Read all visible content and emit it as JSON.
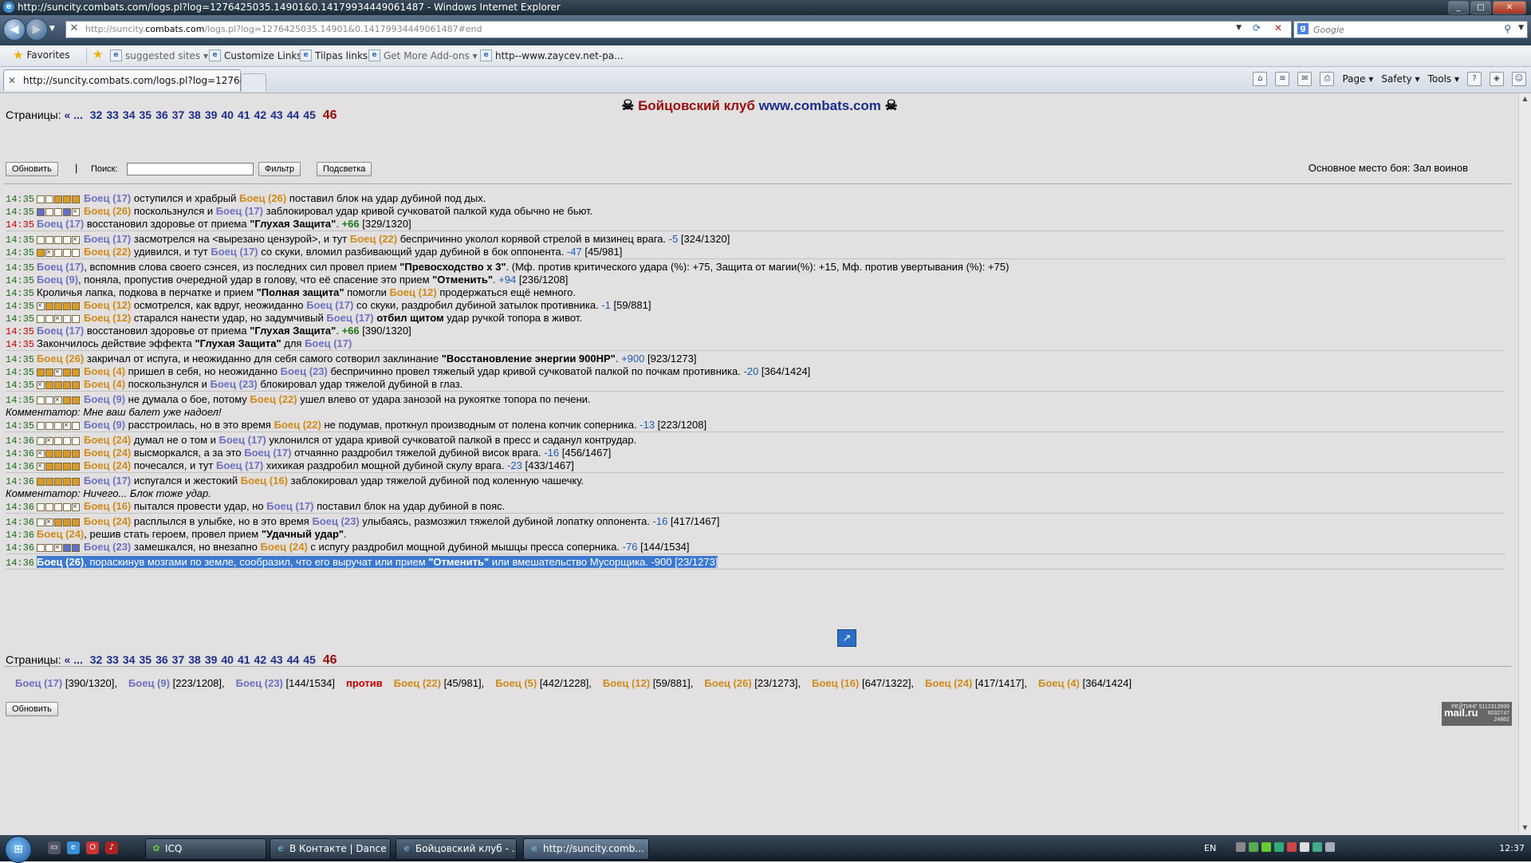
{
  "window": {
    "title": "http://suncity.combats.com/logs.pl?log=1276425035.14901&0.14179934449061487 - Windows Internet Explorer",
    "min": "_",
    "max": "□",
    "close": "✕"
  },
  "address": {
    "url_prefix": "http://suncity.",
    "url_domain": "combats.com",
    "url_suffix": "/logs.pl?log=1276425035.14901&0.14179934449061487#end",
    "search_placeholder": "Google"
  },
  "favorites": {
    "favorites_label": "Favorites",
    "items": [
      "suggested sites ▾",
      "Customize Links",
      "Tilpas links",
      "Get More Add-ons ▾",
      "http--www.zaycev.net-pa..."
    ]
  },
  "tab": {
    "label": "http://suncity.combats.com/logs.pl?log=127642..."
  },
  "commandbar": {
    "page": "Page ▾",
    "safety": "Safety ▾",
    "tools": "Tools ▾"
  },
  "page": {
    "cross": "☠",
    "title_red": "Бойцовский клуб",
    "title_blue": "www.combats.com",
    "pages_label": "Страницы:",
    "pages_prev": "« ...",
    "pages": [
      "32",
      "33",
      "34",
      "35",
      "36",
      "37",
      "38",
      "39",
      "40",
      "41",
      "42",
      "43",
      "44",
      "45"
    ],
    "pages_current": "46",
    "refresh_btn": "Обновить",
    "pipe": "|",
    "search_label": "Поиск:",
    "filter_btn": "Фильтр",
    "highlight_btn": "Подсветка",
    "place": "Основное место боя: Зал воинов",
    "commentator_label": "Комментатор:",
    "vs": "против"
  },
  "log": [
    {
      "g": 1,
      "time": "14:35",
      "tc": "g",
      "boxes": "wwooo",
      "parts": [
        [
          "p1",
          "Боец (17)"
        ],
        [
          "t",
          " оступился и храбрый "
        ],
        [
          "p2",
          "Боец (26)"
        ],
        [
          "t",
          " поставил блок на удар дубиной под дых."
        ]
      ]
    },
    {
      "g": 1,
      "time": "14:35",
      "tc": "g",
      "boxes": "bwwbx",
      "parts": [
        [
          "p2",
          "Боец (26)"
        ],
        [
          "t",
          " поскользнулся и "
        ],
        [
          "p1",
          "Боец (17)"
        ],
        [
          "t",
          " заблокировал удар кривой сучковатой палкой куда обычно не бьют."
        ]
      ]
    },
    {
      "g": 1,
      "end": 1,
      "time": "14:35",
      "tc": "r",
      "parts": [
        [
          "p1",
          "Боец (17)"
        ],
        [
          "t",
          " восстановил здоровье от приема "
        ],
        [
          "b",
          "\"Глухая Защита\""
        ],
        [
          "t",
          ". "
        ],
        [
          "h",
          "+66"
        ],
        [
          "t",
          " [329/1320]"
        ]
      ]
    },
    {
      "g": 2,
      "time": "14:35",
      "tc": "g",
      "boxes": "wwwwx",
      "parts": [
        [
          "p1",
          "Боец (17)"
        ],
        [
          "t",
          " засмотрелся на <вырезано цензурой>, и тут "
        ],
        [
          "p2",
          "Боец (22)"
        ],
        [
          "t",
          " беспричинно уколол корявой стрелой в мизинец врага. "
        ],
        [
          "d",
          "-5"
        ],
        [
          "t",
          " [324/1320]"
        ]
      ]
    },
    {
      "g": 2,
      "end": 1,
      "time": "14:35",
      "tc": "g",
      "boxes": "oxwww",
      "parts": [
        [
          "p2",
          "Боец (22)"
        ],
        [
          "t",
          " удивился, и тут "
        ],
        [
          "p1",
          "Боец (17)"
        ],
        [
          "t",
          " со скуки, вломил разбивающий удар дубиной в бок оппонента. "
        ],
        [
          "d",
          "-47"
        ],
        [
          "t",
          " [45/981]"
        ]
      ]
    },
    {
      "g": 3,
      "time": "14:35",
      "tc": "g",
      "parts": [
        [
          "p1",
          "Боец (17)"
        ],
        [
          "t",
          ", вспомнив слова своего сэнсея, из последних сил провел прием "
        ],
        [
          "b",
          "\"Превосходство x 3\""
        ],
        [
          "t",
          ". (Мф. против критического удара (%): +75, Защита от магии(%): +15, Мф. против увертывания (%): +75)"
        ]
      ]
    },
    {
      "g": 3,
      "time": "14:35",
      "tc": "g",
      "parts": [
        [
          "p1",
          "Боец (9)"
        ],
        [
          "t",
          ", поняла, пропустив очередной удар в голову, что её спасение это прием "
        ],
        [
          "b",
          "\"Отменить\""
        ],
        [
          "t",
          ". "
        ],
        [
          "d",
          "+94"
        ],
        [
          "t",
          " [236/1208]"
        ]
      ]
    },
    {
      "g": 3,
      "time": "14:35",
      "tc": "g",
      "parts": [
        [
          "t",
          "Кроличья лапка, подкова в перчатке и прием "
        ],
        [
          "b",
          "\"Полная защита\""
        ],
        [
          "t",
          " помогли "
        ],
        [
          "p2",
          "Боец (12)"
        ],
        [
          "t",
          " продержаться ещё немного."
        ]
      ]
    },
    {
      "g": 3,
      "time": "14:35",
      "tc": "g",
      "boxes": "xoooo",
      "parts": [
        [
          "p2",
          "Боец (12)"
        ],
        [
          "t",
          " осмотрелся, как вдруг, неожиданно "
        ],
        [
          "p1",
          "Боец (17)"
        ],
        [
          "t",
          " со скуки, раздробил дубиной затылок противника. "
        ],
        [
          "d",
          "-1"
        ],
        [
          "t",
          " [59/881]"
        ]
      ]
    },
    {
      "g": 3,
      "time": "14:35",
      "tc": "g",
      "boxes": "wwxww",
      "parts": [
        [
          "p2",
          "Боец (12)"
        ],
        [
          "t",
          " старался нанести удар, но задумчивый "
        ],
        [
          "p1",
          "Боец (17)"
        ],
        [
          "t",
          " "
        ],
        [
          "b",
          "отбил щитом"
        ],
        [
          "t",
          " удар ручкой топора в живот."
        ]
      ]
    },
    {
      "g": 3,
      "time": "14:35",
      "tc": "r",
      "parts": [
        [
          "p1",
          "Боец (17)"
        ],
        [
          "t",
          " восстановил здоровье от приема "
        ],
        [
          "b",
          "\"Глухая Защита\""
        ],
        [
          "t",
          ". "
        ],
        [
          "h",
          "+66"
        ],
        [
          "t",
          " [390/1320]"
        ]
      ]
    },
    {
      "g": 3,
      "end": 1,
      "time": "14:35",
      "tc": "r",
      "parts": [
        [
          "t",
          "Закончилось действие эффекта "
        ],
        [
          "b",
          "\"Глухая Защита\""
        ],
        [
          "t",
          " для "
        ],
        [
          "p1",
          "Боец (17)"
        ]
      ]
    },
    {
      "g": 4,
      "time": "14:35",
      "tc": "g",
      "parts": [
        [
          "p2",
          "Боец (26)"
        ],
        [
          "t",
          " закричал от испуга, и неожиданно для себя самого сотворил заклинание "
        ],
        [
          "b",
          "\"Восстановление энергии 900HP\""
        ],
        [
          "t",
          ". "
        ],
        [
          "d",
          "+900"
        ],
        [
          "t",
          " [923/1273]"
        ]
      ]
    },
    {
      "g": 4,
      "time": "14:35",
      "tc": "g",
      "boxes": "ooxoo",
      "parts": [
        [
          "p2",
          "Боец (4)"
        ],
        [
          "t",
          " пришел в себя, но неожиданно "
        ],
        [
          "p1",
          "Боец (23)"
        ],
        [
          "t",
          " беспричинно провел тяжелый удар кривой сучковатой палкой по почкам противника. "
        ],
        [
          "d",
          "-20"
        ],
        [
          "t",
          " [364/1424]"
        ]
      ]
    },
    {
      "g": 4,
      "end": 1,
      "time": "14:35",
      "tc": "g",
      "boxes": "xoooo",
      "parts": [
        [
          "p2",
          "Боец (4)"
        ],
        [
          "t",
          " поскользнулся и "
        ],
        [
          "p1",
          "Боец (23)"
        ],
        [
          "t",
          " блокировал удар тяжелой дубиной в глаз."
        ]
      ]
    },
    {
      "g": 5,
      "time": "14:35",
      "tc": "g",
      "boxes": "wwxoo",
      "parts": [
        [
          "p1",
          "Боец (9)"
        ],
        [
          "t",
          " не думала о бое, потому "
        ],
        [
          "p2",
          "Боец (22)"
        ],
        [
          "t",
          " ушел влево от удара занозой на рукоятке топора по печени."
        ]
      ]
    },
    {
      "g": 5,
      "com": 1,
      "parts": [
        [
          "c",
          "Комментатор: Мне ваш балет уже надоел!"
        ]
      ]
    },
    {
      "g": 5,
      "end": 1,
      "time": "14:35",
      "tc": "g",
      "boxes": "wwwxw",
      "parts": [
        [
          "p1",
          "Боец (9)"
        ],
        [
          "t",
          " расстроилась, но в это время "
        ],
        [
          "p2",
          "Боец (22)"
        ],
        [
          "t",
          " не подумав, проткнул производным от полена копчик соперника. "
        ],
        [
          "d",
          "-13"
        ],
        [
          "t",
          " [223/1208]"
        ]
      ]
    },
    {
      "g": 6,
      "time": "14:36",
      "tc": "g",
      "boxes": "wxwww",
      "parts": [
        [
          "p2",
          "Боец (24)"
        ],
        [
          "t",
          " думал не о том и "
        ],
        [
          "p1",
          "Боец (17)"
        ],
        [
          "t",
          " уклонился от удара кривой сучковатой палкой в пресс и саданул контрудар."
        ]
      ]
    },
    {
      "g": 6,
      "time": "14:36",
      "tc": "g",
      "boxes": "xoooo",
      "parts": [
        [
          "p2",
          "Боец (24)"
        ],
        [
          "t",
          " высморкался, а за это "
        ],
        [
          "p1",
          "Боец (17)"
        ],
        [
          "t",
          " отчаянно раздробил тяжелой дубиной висок врага. "
        ],
        [
          "d",
          "-16"
        ],
        [
          "t",
          " [456/1467]"
        ]
      ]
    },
    {
      "g": 6,
      "end": 1,
      "time": "14:36",
      "tc": "g",
      "boxes": "xoooo",
      "parts": [
        [
          "p2",
          "Боец (24)"
        ],
        [
          "t",
          " почесался, и тут "
        ],
        [
          "p1",
          "Боец (17)"
        ],
        [
          "t",
          " хихикая раздробил мощной дубиной скулу врага. "
        ],
        [
          "d",
          "-23"
        ],
        [
          "t",
          " [433/1467]"
        ]
      ]
    },
    {
      "g": 7,
      "time": "14:36",
      "tc": "g",
      "boxes": "ooooo",
      "parts": [
        [
          "p1",
          "Боец (17)"
        ],
        [
          "t",
          " испугался и жестокий "
        ],
        [
          "p2",
          "Боец (16)"
        ],
        [
          "t",
          " заблокировал удар тяжелой дубиной под коленную чашечку."
        ]
      ]
    },
    {
      "g": 7,
      "com": 1,
      "parts": [
        [
          "c",
          "Комментатор: Ничего... Блок тоже удар."
        ]
      ]
    },
    {
      "g": 7,
      "end": 1,
      "time": "14:36",
      "tc": "g",
      "boxes": "wwwwx",
      "parts": [
        [
          "p2",
          "Боец (16)"
        ],
        [
          "t",
          " пытался провести удар, но "
        ],
        [
          "p1",
          "Боец (17)"
        ],
        [
          "t",
          " поставил блок на удар дубиной в пояс."
        ]
      ]
    },
    {
      "g": 8,
      "time": "14:36",
      "tc": "g",
      "boxes": "wxooo",
      "parts": [
        [
          "p2",
          "Боец (24)"
        ],
        [
          "t",
          " расплылся в улыбке, но в это время "
        ],
        [
          "p1",
          "Боец (23)"
        ],
        [
          "t",
          " улыбаясь, размозжил тяжелой дубиной лопатку оппонента. "
        ],
        [
          "d",
          "-16"
        ],
        [
          "t",
          " [417/1467]"
        ]
      ]
    },
    {
      "g": 8,
      "time": "14:36",
      "tc": "g",
      "parts": [
        [
          "p2",
          "Боец (24)"
        ],
        [
          "t",
          ", решив стать героем, провел прием "
        ],
        [
          "b",
          "\"Удачный удар\""
        ],
        [
          "t",
          "."
        ]
      ]
    },
    {
      "g": 8,
      "end": 1,
      "time": "14:36",
      "tc": "g",
      "boxes": "wwxbb",
      "parts": [
        [
          "p1",
          "Боец (23)"
        ],
        [
          "t",
          " замешкался, но внезапно "
        ],
        [
          "p2",
          "Боец (24)"
        ],
        [
          "t",
          " с испугу раздробил мощной дубиной мышцы пресса соперника. "
        ],
        [
          "d",
          "-76"
        ],
        [
          "t",
          " [144/1534]"
        ]
      ]
    },
    {
      "g": 9,
      "end": 1,
      "sel": 1,
      "time": "14:36",
      "tc": "g",
      "parts": [
        [
          "p2",
          "Боец (26)"
        ],
        [
          "t",
          ", пораскинув мозгами по земле, сообразил, что его выручат или прием "
        ],
        [
          "b",
          "\"Отменить\""
        ],
        [
          "t",
          " или вмешательство Мусорщика. "
        ],
        [
          "d",
          "-900"
        ],
        [
          "t",
          " [23/1273]"
        ]
      ]
    }
  ],
  "summary": {
    "team1": [
      [
        "Боец (17)",
        "[390/1320],"
      ],
      [
        "Боец (9)",
        "[223/1208],"
      ],
      [
        "Боец (23)",
        "[144/1534]"
      ]
    ],
    "team2": [
      [
        "Боец (22)",
        "[45/981],"
      ],
      [
        "Боец (5)",
        "[442/1228],"
      ],
      [
        "Боец (12)",
        "[59/881],"
      ],
      [
        "Боец (26)",
        "[23/1273],"
      ],
      [
        "Боец (16)",
        "[647/1322],"
      ],
      [
        "Боец (24)",
        "[417/1417],"
      ],
      [
        "Боец (4)",
        "[364/1424]"
      ]
    ]
  },
  "counter": {
    "brand": "mail.ru",
    "line1": "РЕЙТИНГ 5112313999",
    "line2": "6032747",
    "line3": "24862"
  },
  "taskbar": {
    "buttons": [
      "ICQ",
      "В Контакте | Dance ...",
      "Бойцовский клуб - ...",
      "http://suncity.comb..."
    ],
    "lang": "EN",
    "clock": "12:37"
  },
  "colors": {
    "p1": "#6c72c4",
    "p2": "#d08b1a",
    "select": "#3c79cf",
    "title_red": "#9b0d0d",
    "link_blue": "#1d2e8c"
  }
}
